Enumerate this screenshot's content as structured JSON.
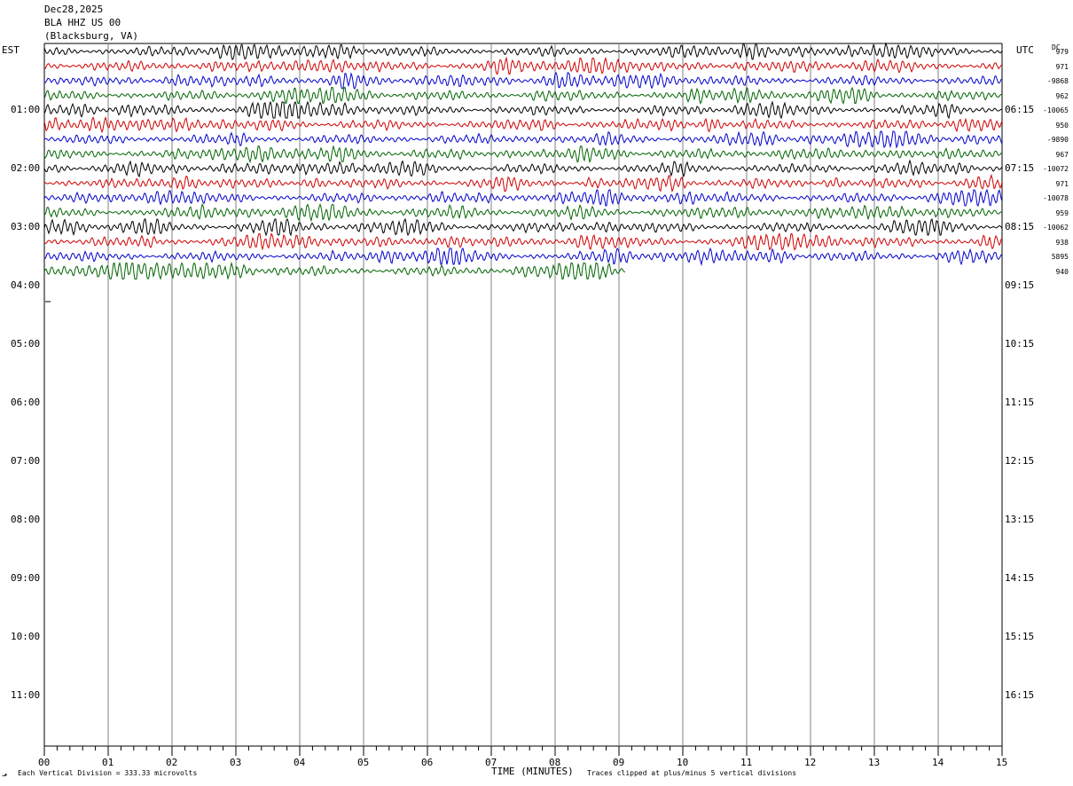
{
  "header": {
    "date": "Dec28,2025",
    "station": "BLA HHZ US 00",
    "location": "(Blacksburg, VA)"
  },
  "left_axis_title": "EST",
  "right_axis_title": "UTC",
  "dc_title": "DC",
  "colors": {
    "trace_cycle": [
      "#000000",
      "#d00000",
      "#0000cc",
      "#006400"
    ],
    "grid": "#808080"
  },
  "footer": {
    "vertical_division": "Each Vertical Division =  333.33 microvolts",
    "xlabel": "TIME (MINUTES)",
    "clip_note": "Traces clipped at plus/minus 5 vertical divisions"
  },
  "chart_data": {
    "type": "line",
    "title": "BLA HHZ US 00",
    "xlabel": "TIME (MINUTES)",
    "x_ticks": [
      "00",
      "01",
      "02",
      "03",
      "04",
      "05",
      "06",
      "07",
      "08",
      "09",
      "10",
      "11",
      "12",
      "13",
      "14",
      "15"
    ],
    "xlim": [
      0,
      15
    ],
    "rows_per_hour": 4,
    "row_minutes": 15,
    "est_hour_labels": [
      "01:00",
      "02:00",
      "03:00",
      "04:00",
      "05:00",
      "06:00",
      "07:00",
      "08:00",
      "09:00",
      "10:00",
      "11:00"
    ],
    "utc_hour_labels": [
      "06:15",
      "07:15",
      "08:15",
      "09:15",
      "10:15",
      "11:15",
      "12:15",
      "13:15",
      "14:15",
      "15:15",
      "16:15"
    ],
    "traces": [
      {
        "row": 0,
        "dc": "979",
        "end_minute": 15
      },
      {
        "row": 1,
        "dc": "971",
        "end_minute": 15
      },
      {
        "row": 2,
        "dc": "-9868",
        "end_minute": 15
      },
      {
        "row": 3,
        "dc": "962",
        "end_minute": 15
      },
      {
        "row": 4,
        "dc": "-10065",
        "end_minute": 15
      },
      {
        "row": 5,
        "dc": "950",
        "end_minute": 15
      },
      {
        "row": 6,
        "dc": "-9890",
        "end_minute": 15
      },
      {
        "row": 7,
        "dc": "967",
        "end_minute": 15
      },
      {
        "row": 8,
        "dc": "-10072",
        "end_minute": 15
      },
      {
        "row": 9,
        "dc": "971",
        "end_minute": 15
      },
      {
        "row": 10,
        "dc": "-10078",
        "end_minute": 15
      },
      {
        "row": 11,
        "dc": "959",
        "end_minute": 15
      },
      {
        "row": 12,
        "dc": "-10062",
        "end_minute": 15
      },
      {
        "row": 13,
        "dc": "938",
        "end_minute": 15
      },
      {
        "row": 14,
        "dc": "5895",
        "end_minute": 15
      },
      {
        "row": 15,
        "dc": "940",
        "end_minute": 9.1
      }
    ]
  }
}
